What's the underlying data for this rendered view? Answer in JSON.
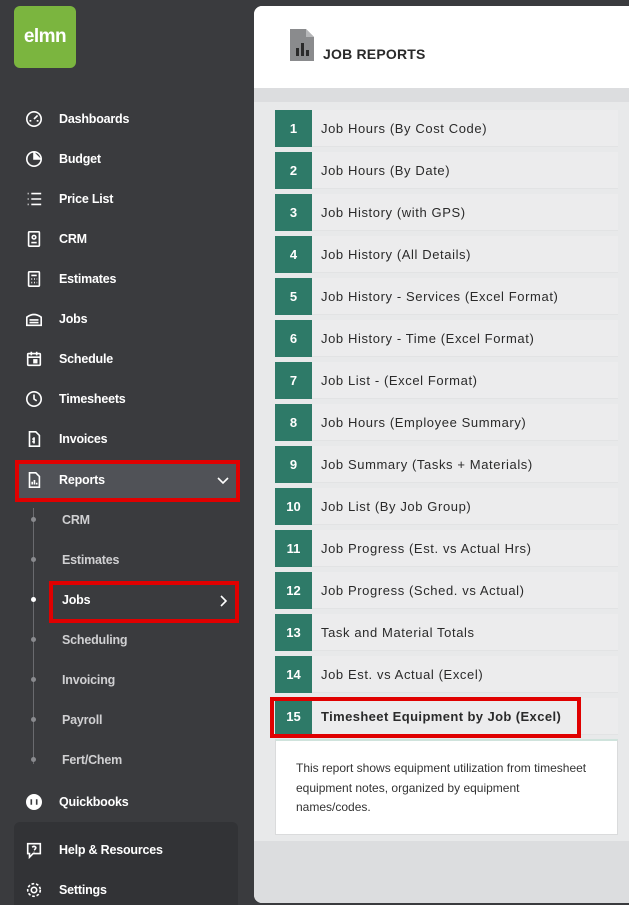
{
  "logo": {
    "text": "elmn"
  },
  "sidebar": {
    "items": [
      {
        "label": "Dashboards",
        "icon": "dashboard-icon"
      },
      {
        "label": "Budget",
        "icon": "pie-chart-icon"
      },
      {
        "label": "Price List",
        "icon": "list-icon"
      },
      {
        "label": "CRM",
        "icon": "contact-icon"
      },
      {
        "label": "Estimates",
        "icon": "calculator-icon"
      },
      {
        "label": "Jobs",
        "icon": "truck-icon"
      },
      {
        "label": "Schedule",
        "icon": "calendar-icon"
      },
      {
        "label": "Timesheets",
        "icon": "clock-icon"
      },
      {
        "label": "Invoices",
        "icon": "invoice-icon"
      },
      {
        "label": "Reports",
        "icon": "report-icon",
        "expanded": true
      }
    ],
    "report_subitems": [
      {
        "label": "CRM"
      },
      {
        "label": "Estimates"
      },
      {
        "label": "Jobs",
        "active": true
      },
      {
        "label": "Scheduling"
      },
      {
        "label": "Invoicing"
      },
      {
        "label": "Payroll"
      },
      {
        "label": "Fert/Chem"
      }
    ],
    "bottom_items": [
      {
        "label": "Quickbooks",
        "icon": "quickbooks-icon"
      },
      {
        "label": "Help & Resources",
        "icon": "help-icon"
      },
      {
        "label": "Settings",
        "icon": "gear-icon"
      }
    ]
  },
  "main": {
    "title": "JOB REPORTS",
    "reports": [
      {
        "num": "1",
        "name": "Job Hours (By Cost Code)"
      },
      {
        "num": "2",
        "name": "Job Hours (By Date)"
      },
      {
        "num": "3",
        "name": "Job History (with GPS)"
      },
      {
        "num": "4",
        "name": "Job History (All Details)"
      },
      {
        "num": "5",
        "name": "Job History - Services (Excel Format)"
      },
      {
        "num": "6",
        "name": "Job History - Time (Excel Format)"
      },
      {
        "num": "7",
        "name": "Job List - (Excel Format)"
      },
      {
        "num": "8",
        "name": "Job Hours (Employee Summary)"
      },
      {
        "num": "9",
        "name": "Job Summary (Tasks + Materials)"
      },
      {
        "num": "10",
        "name": "Job List (By Job Group)"
      },
      {
        "num": "11",
        "name": "Job Progress (Est. vs Actual Hrs)"
      },
      {
        "num": "12",
        "name": "Job Progress (Sched. vs Actual)"
      },
      {
        "num": "13",
        "name": "Task and Material Totals"
      },
      {
        "num": "14",
        "name": "Job Est. vs Actual (Excel)"
      },
      {
        "num": "15",
        "name": "Timesheet Equipment by Job (Excel)",
        "selected": true
      }
    ],
    "description": "This report shows equipment utilization from timesheet equipment notes, organized by equipment names/codes."
  },
  "colors": {
    "brand_green": "#7bb53f",
    "report_num_bg": "#2e7a68",
    "highlight_red": "#e00000",
    "sidebar_bg": "#3a3b3e"
  }
}
